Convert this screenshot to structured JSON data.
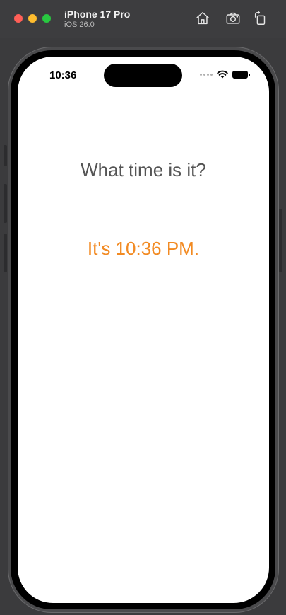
{
  "window": {
    "device_name": "iPhone 17 Pro",
    "os_version": "iOS 26.0",
    "toolbar": {
      "home_icon": "home-icon",
      "screenshot_icon": "camera-icon",
      "rotate_icon": "rotate-icon"
    }
  },
  "status_bar": {
    "time": "10:36"
  },
  "app": {
    "question": "What time is it?",
    "answer": "It's 10:36 PM."
  },
  "colors": {
    "answer": "#f28a22",
    "question": "#555555"
  }
}
